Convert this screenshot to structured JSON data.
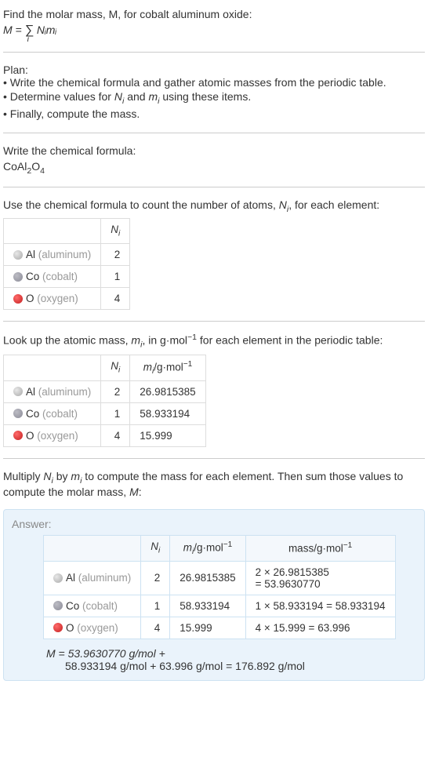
{
  "chart_data": {
    "type": "table",
    "title": "Molar mass of cobalt aluminum oxide (CoAl2O4)",
    "elements": [
      {
        "symbol": "Al",
        "name": "aluminum",
        "N": 2,
        "m": 26.9815385,
        "mass_expr": "2 × 26.9815385 = 53.9630770"
      },
      {
        "symbol": "Co",
        "name": "cobalt",
        "N": 1,
        "m": 58.933194,
        "mass_expr": "1 × 58.933194 = 58.933194"
      },
      {
        "symbol": "O",
        "name": "oxygen",
        "N": 4,
        "m": 15.999,
        "mass_expr": "4 × 15.999 = 63.996"
      }
    ],
    "molar_mass": "176.892 g/mol"
  },
  "intro": {
    "line": "Find the molar mass, M, for cobalt aluminum oxide:",
    "formula_prefix": "M = ",
    "formula_sigma": "∑",
    "formula_sub": "i",
    "formula_body": " Nᵢmᵢ"
  },
  "plan": {
    "heading": "Plan:",
    "b1": "• Write the chemical formula and gather atomic masses from the periodic table.",
    "b2_a": "• Determine values for ",
    "b2_ni": "N",
    "b2_ni_sub": "i",
    "b2_b": " and ",
    "b2_mi": "m",
    "b2_mi_sub": "i",
    "b2_c": " using these items.",
    "b3": "• Finally, compute the mass."
  },
  "step_formula": {
    "heading": "Write the chemical formula:",
    "f_a": "CoAl",
    "f_b": "2",
    "f_c": "O",
    "f_d": "4"
  },
  "step_count": {
    "heading_a": "Use the chemical formula to count the number of atoms, ",
    "heading_ni": "N",
    "heading_ni_sub": "i",
    "heading_b": ", for each element:",
    "col_n": "N",
    "col_n_sub": "i",
    "rows": [
      {
        "sym": "Al",
        "name": "(aluminum)",
        "n": "2"
      },
      {
        "sym": "Co",
        "name": "(cobalt)",
        "n": "1"
      },
      {
        "sym": "O",
        "name": "(oxygen)",
        "n": "4"
      }
    ]
  },
  "step_mass": {
    "heading_a": "Look up the atomic mass, ",
    "heading_mi": "m",
    "heading_mi_sub": "i",
    "heading_b": ", in g·mol",
    "heading_sup": "−1",
    "heading_c": " for each element in the periodic table:",
    "col_n": "N",
    "col_n_sub": "i",
    "col_m_a": "m",
    "col_m_sub": "i",
    "col_m_b": "/g·mol",
    "col_m_sup": "−1",
    "rows": [
      {
        "sym": "Al",
        "name": "(aluminum)",
        "n": "2",
        "m": "26.9815385"
      },
      {
        "sym": "Co",
        "name": "(cobalt)",
        "n": "1",
        "m": "58.933194"
      },
      {
        "sym": "O",
        "name": "(oxygen)",
        "n": "4",
        "m": "15.999"
      }
    ]
  },
  "step_multiply": {
    "heading_a": "Multiply ",
    "ni": "N",
    "ni_sub": "i",
    "heading_b": " by ",
    "mi": "m",
    "mi_sub": "i",
    "heading_c": " to compute the mass for each element. Then sum those values to compute the molar mass, ",
    "M": "M",
    "heading_d": ":"
  },
  "answer": {
    "label": "Answer:",
    "col_n": "N",
    "col_n_sub": "i",
    "col_m_a": "m",
    "col_m_sub": "i",
    "col_m_b": "/g·mol",
    "col_m_sup": "−1",
    "col_mass_a": "mass/g·mol",
    "col_mass_sup": "−1",
    "rows": [
      {
        "sym": "Al",
        "name": "(aluminum)",
        "n": "2",
        "m": "26.9815385",
        "mass_a": "2 × 26.9815385",
        "mass_b": "= 53.9630770"
      },
      {
        "sym": "Co",
        "name": "(cobalt)",
        "n": "1",
        "m": "58.933194",
        "mass_a": "1 × 58.933194 = 58.933194",
        "mass_b": ""
      },
      {
        "sym": "O",
        "name": "(oxygen)",
        "n": "4",
        "m": "15.999",
        "mass_a": "4 × 15.999 = 63.996",
        "mass_b": ""
      }
    ],
    "final_a": "M = 53.9630770 g/mol +",
    "final_b": "58.933194 g/mol + 63.996 g/mol = 176.892 g/mol"
  }
}
